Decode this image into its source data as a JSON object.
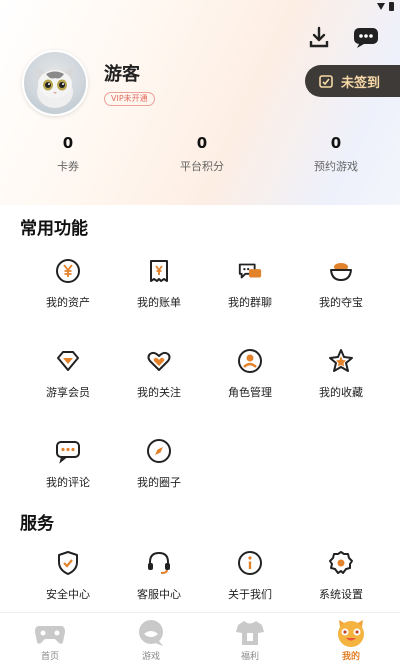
{
  "header": {
    "download_icon": "download-icon",
    "message_icon": "chat-bubble-icon"
  },
  "profile": {
    "username": "游客",
    "vip_badge": "VIP未开通",
    "signin_label": "未签到"
  },
  "stats": [
    {
      "value": "0",
      "label": "卡券"
    },
    {
      "value": "0",
      "label": "平台积分"
    },
    {
      "value": "0",
      "label": "预约游戏"
    }
  ],
  "common": {
    "title": "常用功能",
    "items": [
      {
        "label": "我的资产",
        "icon": "yen-coin-icon"
      },
      {
        "label": "我的账单",
        "icon": "bill-icon"
      },
      {
        "label": "我的群聊",
        "icon": "group-chat-icon"
      },
      {
        "label": "我的夺宝",
        "icon": "treasure-bowl-icon"
      },
      {
        "label": "游享会员",
        "icon": "diamond-icon"
      },
      {
        "label": "我的关注",
        "icon": "heart-icon"
      },
      {
        "label": "角色管理",
        "icon": "user-circle-icon"
      },
      {
        "label": "我的收藏",
        "icon": "star-icon"
      },
      {
        "label": "我的评论",
        "icon": "comment-icon"
      },
      {
        "label": "我的圈子",
        "icon": "compass-icon"
      }
    ]
  },
  "service": {
    "title": "服务",
    "items": [
      {
        "label": "安全中心",
        "icon": "shield-icon"
      },
      {
        "label": "客服中心",
        "icon": "headset-icon"
      },
      {
        "label": "关于我们",
        "icon": "info-icon"
      },
      {
        "label": "系统设置",
        "icon": "gear-icon"
      }
    ]
  },
  "tabs": [
    {
      "label": "首页",
      "icon": "gamepad-icon",
      "active": false
    },
    {
      "label": "游戏",
      "icon": "game-bubble-icon",
      "active": false
    },
    {
      "label": "福利",
      "icon": "gift-shirt-icon",
      "active": false
    },
    {
      "label": "我的",
      "icon": "smiley-cat-icon",
      "active": true
    }
  ],
  "colors": {
    "accent": "#e2822b",
    "signin_bg": "#3d3a38",
    "signin_text": "#f6d9a6"
  }
}
